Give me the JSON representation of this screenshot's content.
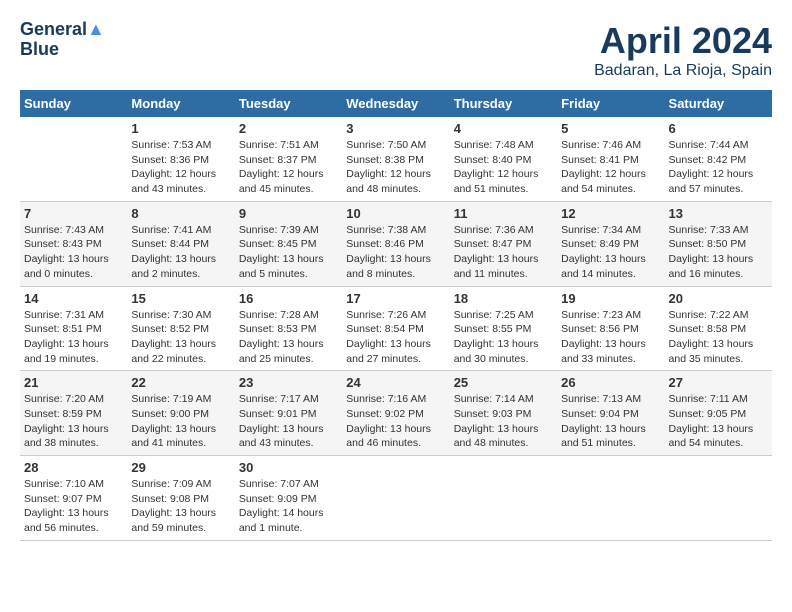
{
  "header": {
    "logo_line1": "General",
    "logo_line2": "Blue",
    "month_title": "April 2024",
    "subtitle": "Badaran, La Rioja, Spain"
  },
  "days_of_week": [
    "Sunday",
    "Monday",
    "Tuesday",
    "Wednesday",
    "Thursday",
    "Friday",
    "Saturday"
  ],
  "weeks": [
    [
      {
        "day": "",
        "info": ""
      },
      {
        "day": "1",
        "info": "Sunrise: 7:53 AM\nSunset: 8:36 PM\nDaylight: 12 hours\nand 43 minutes."
      },
      {
        "day": "2",
        "info": "Sunrise: 7:51 AM\nSunset: 8:37 PM\nDaylight: 12 hours\nand 45 minutes."
      },
      {
        "day": "3",
        "info": "Sunrise: 7:50 AM\nSunset: 8:38 PM\nDaylight: 12 hours\nand 48 minutes."
      },
      {
        "day": "4",
        "info": "Sunrise: 7:48 AM\nSunset: 8:40 PM\nDaylight: 12 hours\nand 51 minutes."
      },
      {
        "day": "5",
        "info": "Sunrise: 7:46 AM\nSunset: 8:41 PM\nDaylight: 12 hours\nand 54 minutes."
      },
      {
        "day": "6",
        "info": "Sunrise: 7:44 AM\nSunset: 8:42 PM\nDaylight: 12 hours\nand 57 minutes."
      }
    ],
    [
      {
        "day": "7",
        "info": "Sunrise: 7:43 AM\nSunset: 8:43 PM\nDaylight: 13 hours\nand 0 minutes."
      },
      {
        "day": "8",
        "info": "Sunrise: 7:41 AM\nSunset: 8:44 PM\nDaylight: 13 hours\nand 2 minutes."
      },
      {
        "day": "9",
        "info": "Sunrise: 7:39 AM\nSunset: 8:45 PM\nDaylight: 13 hours\nand 5 minutes."
      },
      {
        "day": "10",
        "info": "Sunrise: 7:38 AM\nSunset: 8:46 PM\nDaylight: 13 hours\nand 8 minutes."
      },
      {
        "day": "11",
        "info": "Sunrise: 7:36 AM\nSunset: 8:47 PM\nDaylight: 13 hours\nand 11 minutes."
      },
      {
        "day": "12",
        "info": "Sunrise: 7:34 AM\nSunset: 8:49 PM\nDaylight: 13 hours\nand 14 minutes."
      },
      {
        "day": "13",
        "info": "Sunrise: 7:33 AM\nSunset: 8:50 PM\nDaylight: 13 hours\nand 16 minutes."
      }
    ],
    [
      {
        "day": "14",
        "info": "Sunrise: 7:31 AM\nSunset: 8:51 PM\nDaylight: 13 hours\nand 19 minutes."
      },
      {
        "day": "15",
        "info": "Sunrise: 7:30 AM\nSunset: 8:52 PM\nDaylight: 13 hours\nand 22 minutes."
      },
      {
        "day": "16",
        "info": "Sunrise: 7:28 AM\nSunset: 8:53 PM\nDaylight: 13 hours\nand 25 minutes."
      },
      {
        "day": "17",
        "info": "Sunrise: 7:26 AM\nSunset: 8:54 PM\nDaylight: 13 hours\nand 27 minutes."
      },
      {
        "day": "18",
        "info": "Sunrise: 7:25 AM\nSunset: 8:55 PM\nDaylight: 13 hours\nand 30 minutes."
      },
      {
        "day": "19",
        "info": "Sunrise: 7:23 AM\nSunset: 8:56 PM\nDaylight: 13 hours\nand 33 minutes."
      },
      {
        "day": "20",
        "info": "Sunrise: 7:22 AM\nSunset: 8:58 PM\nDaylight: 13 hours\nand 35 minutes."
      }
    ],
    [
      {
        "day": "21",
        "info": "Sunrise: 7:20 AM\nSunset: 8:59 PM\nDaylight: 13 hours\nand 38 minutes."
      },
      {
        "day": "22",
        "info": "Sunrise: 7:19 AM\nSunset: 9:00 PM\nDaylight: 13 hours\nand 41 minutes."
      },
      {
        "day": "23",
        "info": "Sunrise: 7:17 AM\nSunset: 9:01 PM\nDaylight: 13 hours\nand 43 minutes."
      },
      {
        "day": "24",
        "info": "Sunrise: 7:16 AM\nSunset: 9:02 PM\nDaylight: 13 hours\nand 46 minutes."
      },
      {
        "day": "25",
        "info": "Sunrise: 7:14 AM\nSunset: 9:03 PM\nDaylight: 13 hours\nand 48 minutes."
      },
      {
        "day": "26",
        "info": "Sunrise: 7:13 AM\nSunset: 9:04 PM\nDaylight: 13 hours\nand 51 minutes."
      },
      {
        "day": "27",
        "info": "Sunrise: 7:11 AM\nSunset: 9:05 PM\nDaylight: 13 hours\nand 54 minutes."
      }
    ],
    [
      {
        "day": "28",
        "info": "Sunrise: 7:10 AM\nSunset: 9:07 PM\nDaylight: 13 hours\nand 56 minutes."
      },
      {
        "day": "29",
        "info": "Sunrise: 7:09 AM\nSunset: 9:08 PM\nDaylight: 13 hours\nand 59 minutes."
      },
      {
        "day": "30",
        "info": "Sunrise: 7:07 AM\nSunset: 9:09 PM\nDaylight: 14 hours\nand 1 minute."
      },
      {
        "day": "",
        "info": ""
      },
      {
        "day": "",
        "info": ""
      },
      {
        "day": "",
        "info": ""
      },
      {
        "day": "",
        "info": ""
      }
    ]
  ]
}
